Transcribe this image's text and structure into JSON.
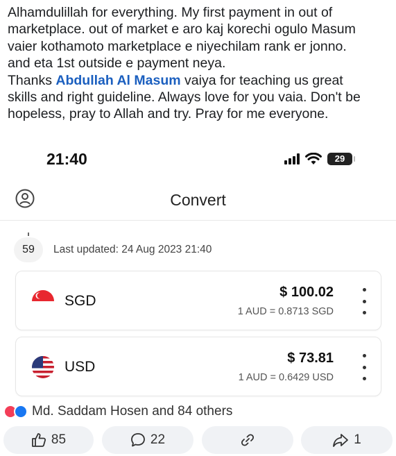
{
  "post": {
    "text_line_1": "Alhamdulillah for everything. My first payment in out of",
    "text_line_2": "marketplace. out of market e aro kaj korechi ogulo Masum",
    "text_line_3": "vaier kothamoto marketplace e niyechilam rank er jonno.",
    "text_line_4": "and eta 1st outside e payment neya.",
    "text_line_5_prefix": "Thanks ",
    "mention": "Abdullah Al Masum",
    "text_line_5_suffix": " vaiya for teaching us great",
    "text_line_6": "skills and right guideline. Always love for you vaia. Don't be",
    "text_line_7": "hopeless, pray to Allah and try. Pray for me everyone."
  },
  "screenshot": {
    "status_time": "21:40",
    "battery": "29",
    "app_title": "Convert",
    "timer": "59",
    "last_updated": "Last updated: 24 Aug 2023 21:40",
    "currencies": [
      {
        "code": "SGD",
        "amount": "$ 100.02",
        "rate": "1 AUD = 0.8713 SGD",
        "flag": "singapore-flag"
      },
      {
        "code": "USD",
        "amount": "$ 73.81",
        "rate": "1 AUD = 0.6429 USD",
        "flag": "us-flag"
      }
    ]
  },
  "reactions": {
    "text": "Md. Saddam Hosen and 84 others",
    "icons": [
      "love-icon",
      "like-icon"
    ]
  },
  "actions": {
    "like_count": "85",
    "comment_count": "22",
    "share_count": "1"
  },
  "colors": {
    "mention": "#1b5fbf",
    "love": "#f33e58",
    "like": "#1877f2",
    "action_bg": "#f0f2f5"
  }
}
